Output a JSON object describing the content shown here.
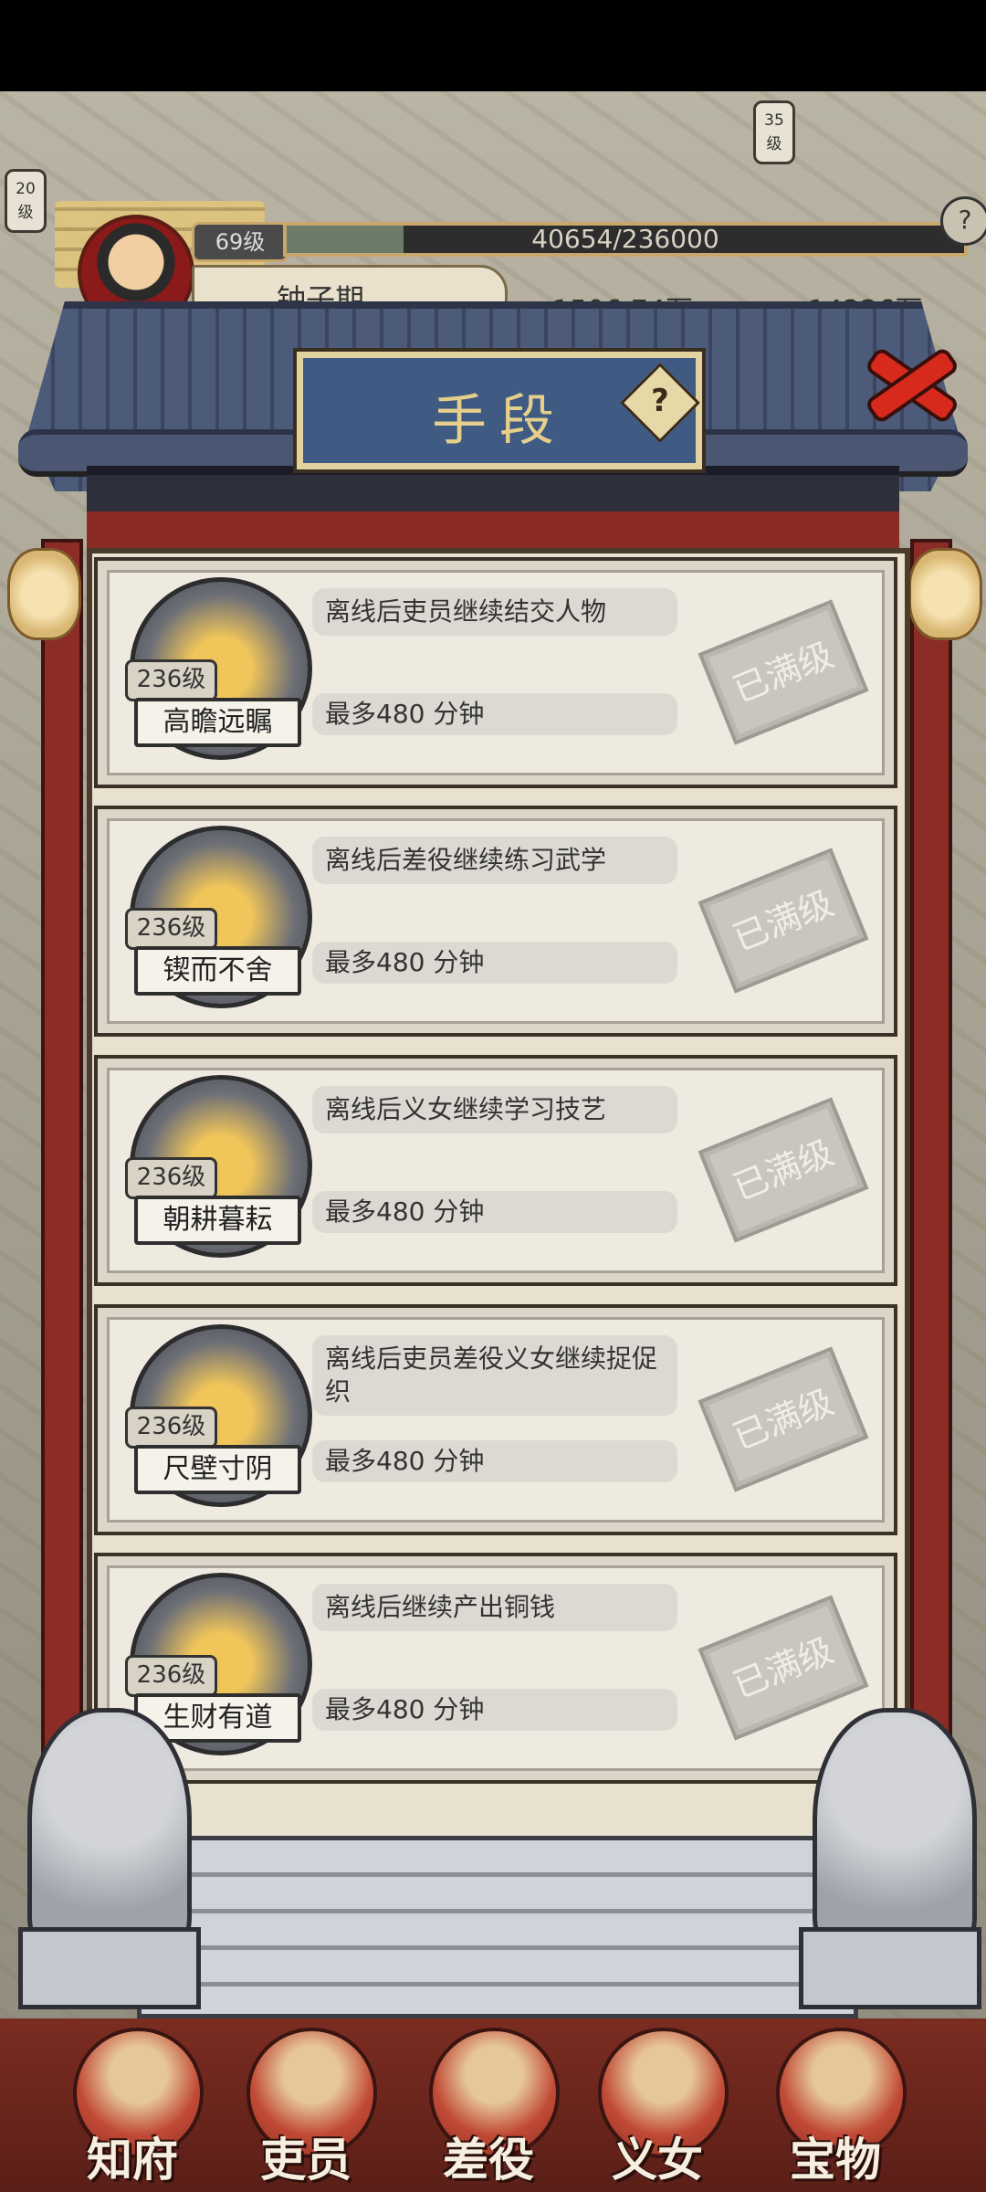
{
  "map": {
    "badge_left": "20\n级",
    "badge_right": "35\n级"
  },
  "player": {
    "level": "69级",
    "xp": "40654/236000",
    "xp_fraction": 0.172,
    "name": "钟子期",
    "resource_1": "1506.74万",
    "resource_2": "14226万"
  },
  "dialog": {
    "title": "手段",
    "help": "?"
  },
  "cards": [
    {
      "name": "高瞻远瞩",
      "level": "236级",
      "desc": "离线后吏员继续结交人物",
      "limit": "最多480 分钟",
      "status": "已满级",
      "icon": "officials-icon"
    },
    {
      "name": "锲而不舍",
      "level": "236级",
      "desc": "离线后差役继续练习武学",
      "limit": "最多480 分钟",
      "status": "已满级",
      "icon": "martial-artist-icon"
    },
    {
      "name": "朝耕暮耘",
      "level": "236级",
      "desc": "离线后义女继续学习技艺",
      "limit": "最多480 分钟",
      "status": "已满级",
      "icon": "instrument-icon"
    },
    {
      "name": "尺壁寸阴",
      "level": "236级",
      "desc": "离线后吏员差役义女继续捉促织",
      "limit": "最多480 分钟",
      "status": "已满级",
      "icon": "cricket-bowl-icon"
    },
    {
      "name": "生财有道",
      "level": "236级",
      "desc": "离线后继续产出铜钱",
      "limit": "最多480 分钟",
      "status": "已满级",
      "icon": "recommend-scroll-icon"
    }
  ],
  "nav": [
    {
      "label": "知府"
    },
    {
      "label": "吏员"
    },
    {
      "label": "差役"
    },
    {
      "label": "义女"
    },
    {
      "label": "宝物"
    }
  ]
}
